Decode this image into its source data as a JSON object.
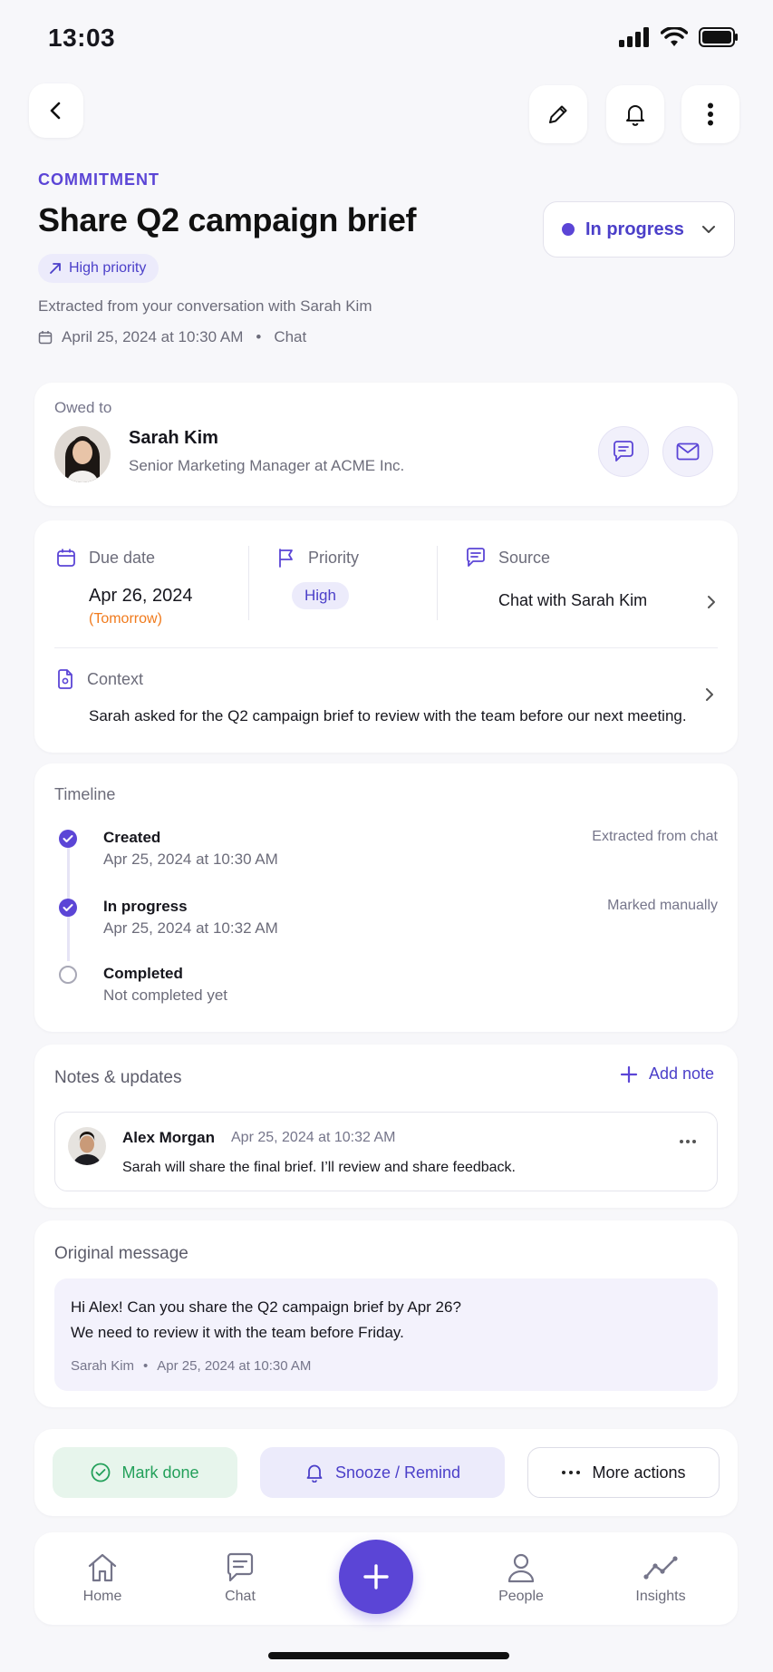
{
  "status_bar": {
    "time": "13:03"
  },
  "header": {
    "eyebrow": "COMMITMENT",
    "title": "Share Q2 campaign brief",
    "priority_chip": "High priority",
    "status": "In progress",
    "extracted_from": "Extracted from your conversation with Sarah Kim",
    "date": "April 25, 2024 at 10:30 AM",
    "separator": "•",
    "source_type": "Chat"
  },
  "owed_to": {
    "label": "Owed to",
    "name": "Sarah Kim",
    "role": "Senior Marketing Manager at ACME Inc."
  },
  "details": {
    "due_label": "Due date",
    "due_value": "Apr 26, 2024",
    "due_relative": "(Tomorrow)",
    "priority_label": "Priority",
    "priority_value": "High",
    "source_label": "Source",
    "source_value": "Chat with Sarah Kim",
    "context_label": "Context",
    "context_value": "Sarah asked for the Q2 campaign brief to review with the team before our next meeting."
  },
  "timeline": {
    "title": "Timeline",
    "items": [
      {
        "title": "Created",
        "time": "Apr 25, 2024 at 10:30 AM",
        "note": "Extracted from chat",
        "done": true
      },
      {
        "title": "In progress",
        "time": "Apr 25, 2024 at 10:32 AM",
        "note": "Marked manually",
        "done": true
      },
      {
        "title": "Completed",
        "time": "Not completed yet",
        "note": "",
        "done": false
      }
    ]
  },
  "notes": {
    "title": "Notes & updates",
    "add_label": "Add note",
    "items": [
      {
        "author": "Alex Morgan",
        "time": "Apr 25, 2024 at 10:32 AM",
        "text": "Sarah will share the final brief. I’ll review and share feedback."
      }
    ]
  },
  "original": {
    "title": "Original message",
    "line1": "Hi Alex! Can you share the Q2 campaign brief by Apr 26?",
    "line2": "We need to review it with the team before Friday.",
    "sender": "Sarah Kim",
    "separator": "•",
    "time": "Apr 25, 2024 at 10:30 AM"
  },
  "actions": {
    "done": "Mark done",
    "snooze": "Snooze / Remind",
    "more": "More actions"
  },
  "nav": {
    "home": "Home",
    "chat": "Chat",
    "people": "People",
    "insights": "Insights"
  },
  "colors": {
    "accent": "#5b45d6",
    "accent_soft": "#ecebfb",
    "success": "#23a05a",
    "warning": "#f07a1c"
  }
}
